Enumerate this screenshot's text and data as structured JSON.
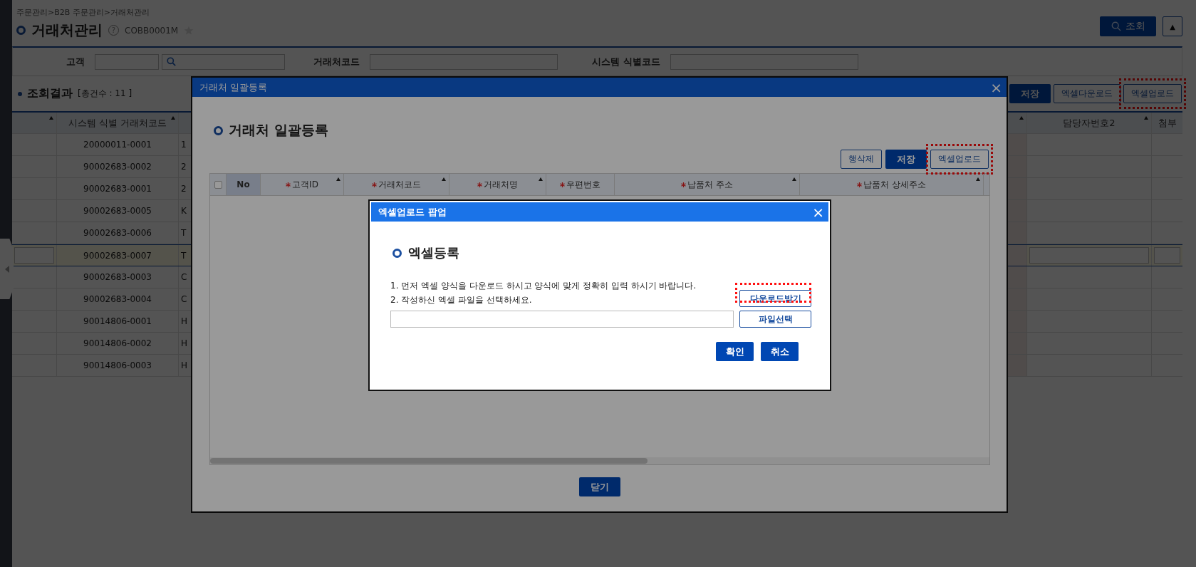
{
  "page": {
    "breadcrumb": "주문관리>B2B 주문관리>거래처관리",
    "title": "거래처관리",
    "help": "?",
    "screen_code": "COBB0001M",
    "search_button": "조회",
    "toggle": "▲"
  },
  "filters": [
    {
      "label": "고객",
      "kind": "lookup"
    },
    {
      "label": "거래처코드",
      "kind": "text"
    },
    {
      "label": "시스템 식별코드",
      "kind": "text"
    }
  ],
  "results": {
    "title": "조회결과",
    "count_text": "[총건수 :  11 ]",
    "buttons": [
      {
        "label": "저장",
        "kind": "primary",
        "highlighted": false
      },
      {
        "label": "엑셀다운로드",
        "kind": "outline",
        "highlighted": false
      },
      {
        "label": "엑셀업로드",
        "kind": "outline",
        "highlighted": true
      }
    ]
  },
  "grid": {
    "columns": [
      {
        "label": "시스템 식별 거래처코드"
      },
      {
        "label": "담당자번호2"
      },
      {
        "label": "첨부"
      }
    ],
    "rows": [
      {
        "code": "20000011-0001",
        "column_3": "1",
        "selected": false
      },
      {
        "code": "90002683-0002",
        "column_3": "2",
        "selected": false
      },
      {
        "code": "90002683-0001",
        "column_3": "2",
        "selected": false
      },
      {
        "code": "90002683-0005",
        "column_3": "K",
        "selected": false
      },
      {
        "code": "90002683-0006",
        "column_3": "T",
        "selected": false
      },
      {
        "code": "90002683-0007",
        "column_3": "T",
        "selected": true
      },
      {
        "code": "90002683-0003",
        "column_3": "C",
        "selected": false
      },
      {
        "code": "90002683-0004",
        "column_3": "C",
        "selected": false
      },
      {
        "code": "90014806-0001",
        "column_3": "H",
        "selected": false
      },
      {
        "code": "90014806-0002",
        "column_3": "H",
        "selected": false
      },
      {
        "code": "90014806-0003",
        "column_3": "H",
        "selected": false
      }
    ]
  },
  "modal": {
    "title": "거래처 일괄등록",
    "close": "×",
    "heading": "거래처 일괄등록",
    "buttons": [
      {
        "label": "행삭제",
        "kind": "outline",
        "highlighted": false
      },
      {
        "label": "저장",
        "kind": "primary",
        "highlighted": false
      },
      {
        "label": "엑셀업로드",
        "kind": "outline",
        "highlighted": true
      }
    ],
    "select_all": {
      "checked": false
    },
    "columns": [
      {
        "label": "No",
        "required": false,
        "sortable": false
      },
      {
        "label": "고객ID",
        "required": true,
        "sortable": true
      },
      {
        "label": "거래처코드",
        "required": true,
        "sortable": true
      },
      {
        "label": "거래처명",
        "required": true,
        "sortable": true
      },
      {
        "label": "우편번호",
        "required": true,
        "sortable": false
      },
      {
        "label": "납품처 주소",
        "required": true,
        "sortable": true
      },
      {
        "label": "납품처 상세주소",
        "required": true,
        "sortable": true
      }
    ],
    "close_button": "닫기"
  },
  "popup": {
    "title": "엑셀업로드 팝업",
    "close": "×",
    "heading": "엑셀등록",
    "instructions": [
      "1. 먼저 엑셀 양식을 다운로드 하시고 양식에 맞게 정확히 입력 하시기 바랍니다.",
      "2. 작성하신 엑셀 파일을 선택하세요."
    ],
    "download_button": {
      "label": "다운로드받기",
      "highlighted": true
    },
    "file_button": "파일선택",
    "buttons": [
      {
        "label": "확인"
      },
      {
        "label": "취소"
      }
    ]
  }
}
